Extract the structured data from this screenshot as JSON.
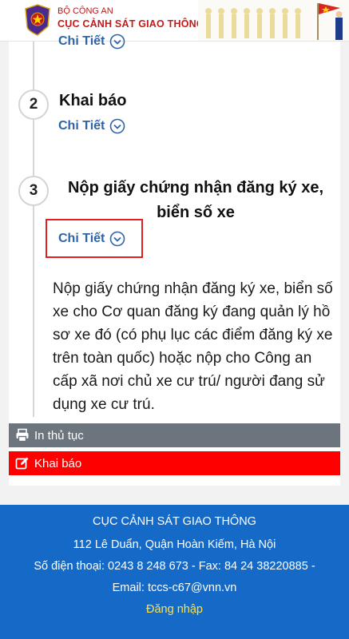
{
  "header": {
    "org_small": "BỘ CÔNG AN",
    "org_big": "CỤC CẢNH SÁT GIAO THÔNG"
  },
  "steps": [
    {
      "number": "",
      "title": "",
      "detail_label": "Chi Tiết"
    },
    {
      "number": "2",
      "title": "Khai báo",
      "detail_label": "Chi Tiết"
    },
    {
      "number": "3",
      "title_line1": "Nộp giấy chứng nhận đăng ký xe,",
      "title_line2": "biển số xe",
      "detail_label": "Chi Tiết"
    }
  ],
  "step3_description": "Nộp giấy chứng nhận đăng ký xe, biển số xe cho Cơ quan đăng ký đang quản lý hồ sơ xe đó (có phụ lục các điểm đăng ký xe trên toàn quốc) hoặc nộp cho Công an cấp xã nơi chủ xe cư trú/ người đang sử dụng xe cư trú.",
  "actions": {
    "print_label": "In thủ tục",
    "declare_label": "Khai báo"
  },
  "footer": {
    "org": "CỤC CẢNH SÁT GIAO THÔNG",
    "address": "112 Lê Duẩn, Quận Hoàn Kiếm, Hà Nội",
    "phone": "Số điện thoại: 0243 8 248 673 - Fax: 84 24 38220885 -",
    "email": "Email: tccs-c67@vnn.vn",
    "login": "Đăng nhập"
  },
  "colors": {
    "link": "#2f63a8",
    "print_button": "#6c757d",
    "declare_button": "#ff0000",
    "footer_bg": "#1569c7",
    "login_text": "#ffe24a"
  }
}
